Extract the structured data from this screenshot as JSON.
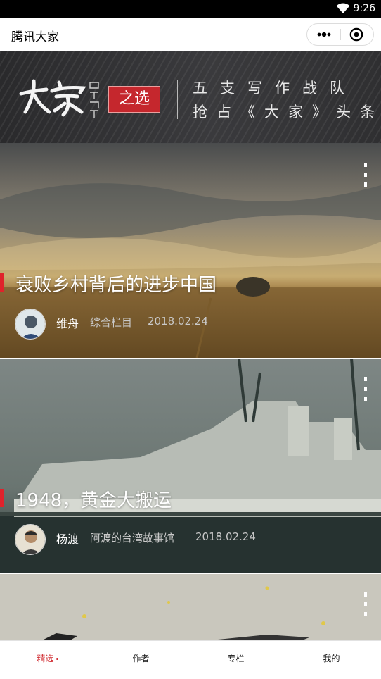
{
  "status_bar": {
    "time": "9:26",
    "wifi_icon": "wifi-icon"
  },
  "title_bar": {
    "title": "腾讯大家",
    "more_icon": "more-dots-icon",
    "close_icon": "target-close-icon"
  },
  "banner": {
    "logo_text": "大家",
    "collection_text": "collection DAJIA",
    "badge": "之选",
    "line1": "五支写作战队",
    "line2": "抢占《大家》头条"
  },
  "articles": [
    {
      "title": "衰败乡村背后的进步中国",
      "author": "维舟",
      "column": "综合栏目",
      "date": "2018.02.24",
      "menu_icon": "more-vertical-icon"
    },
    {
      "title": "1948，黄金大搬运",
      "author": "杨渡",
      "column": "阿渡的台湾故事馆",
      "date": "2018.02.24",
      "menu_icon": "more-vertical-icon"
    },
    {
      "menu_icon": "more-vertical-icon"
    }
  ],
  "tabbar": {
    "tabs": [
      {
        "label": "精选",
        "active": true
      },
      {
        "label": "作者",
        "active": false
      },
      {
        "label": "专栏",
        "active": false
      },
      {
        "label": "我的",
        "active": false
      }
    ],
    "accent": "#d0282e"
  }
}
